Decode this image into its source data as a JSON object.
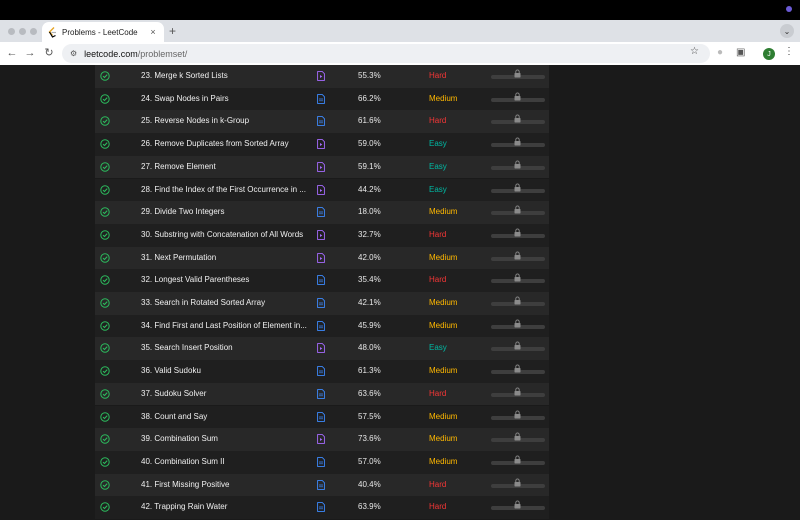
{
  "browser": {
    "tab_title": "Problems - LeetCode",
    "tab_close": "×",
    "new_tab": "+",
    "tab_menu": "⌄",
    "back": "←",
    "forward": "→",
    "reload": "↻",
    "url_host": "leetcode.com",
    "url_path": "/problemset/",
    "star": "☆",
    "profile_initial": "J",
    "menu": "⋮"
  },
  "problems": [
    {
      "title": "23. Merge k Sorted Lists",
      "solution": "video",
      "acceptance": "55.3%",
      "difficulty": "Hard"
    },
    {
      "title": "24. Swap Nodes in Pairs",
      "solution": "article",
      "acceptance": "66.2%",
      "difficulty": "Medium"
    },
    {
      "title": "25. Reverse Nodes in k-Group",
      "solution": "article",
      "acceptance": "61.6%",
      "difficulty": "Hard"
    },
    {
      "title": "26. Remove Duplicates from Sorted Array",
      "solution": "video",
      "acceptance": "59.0%",
      "difficulty": "Easy"
    },
    {
      "title": "27. Remove Element",
      "solution": "video",
      "acceptance": "59.1%",
      "difficulty": "Easy"
    },
    {
      "title": "28. Find the Index of the First Occurrence in ...",
      "solution": "video",
      "acceptance": "44.2%",
      "difficulty": "Easy"
    },
    {
      "title": "29. Divide Two Integers",
      "solution": "article",
      "acceptance": "18.0%",
      "difficulty": "Medium"
    },
    {
      "title": "30. Substring with Concatenation of All Words",
      "solution": "video",
      "acceptance": "32.7%",
      "difficulty": "Hard"
    },
    {
      "title": "31. Next Permutation",
      "solution": "video",
      "acceptance": "42.0%",
      "difficulty": "Medium"
    },
    {
      "title": "32. Longest Valid Parentheses",
      "solution": "article",
      "acceptance": "35.4%",
      "difficulty": "Hard"
    },
    {
      "title": "33. Search in Rotated Sorted Array",
      "solution": "article",
      "acceptance": "42.1%",
      "difficulty": "Medium"
    },
    {
      "title": "34. Find First and Last Position of Element in...",
      "solution": "article",
      "acceptance": "45.9%",
      "difficulty": "Medium"
    },
    {
      "title": "35. Search Insert Position",
      "solution": "video",
      "acceptance": "48.0%",
      "difficulty": "Easy"
    },
    {
      "title": "36. Valid Sudoku",
      "solution": "article",
      "acceptance": "61.3%",
      "difficulty": "Medium"
    },
    {
      "title": "37. Sudoku Solver",
      "solution": "article",
      "acceptance": "63.6%",
      "difficulty": "Hard"
    },
    {
      "title": "38. Count and Say",
      "solution": "article",
      "acceptance": "57.5%",
      "difficulty": "Medium"
    },
    {
      "title": "39. Combination Sum",
      "solution": "video",
      "acceptance": "73.6%",
      "difficulty": "Medium"
    },
    {
      "title": "40. Combination Sum II",
      "solution": "article",
      "acceptance": "57.0%",
      "difficulty": "Medium"
    },
    {
      "title": "41. First Missing Positive",
      "solution": "article",
      "acceptance": "40.4%",
      "difficulty": "Hard"
    },
    {
      "title": "42. Trapping Rain Water",
      "solution": "article",
      "acceptance": "63.9%",
      "difficulty": "Hard"
    }
  ],
  "colors": {
    "hard": "#f63636",
    "medium": "#ffb800",
    "easy": "#00b8a3",
    "solved_check": "#2cbb5d",
    "video_icon": "#a66bff",
    "article_icon": "#3d8bff"
  }
}
